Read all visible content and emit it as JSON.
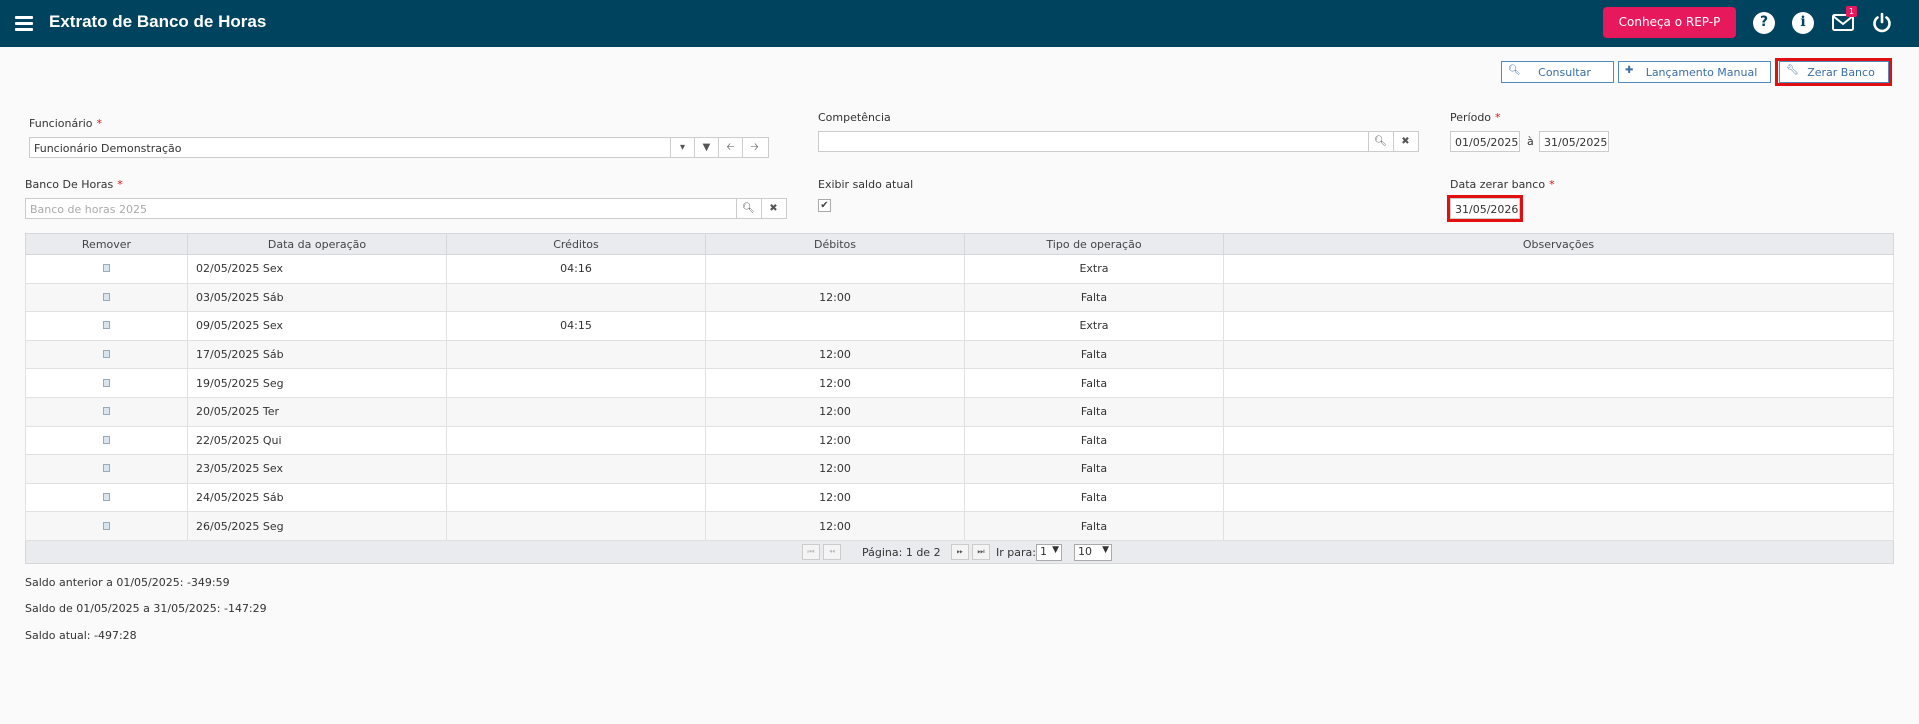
{
  "header": {
    "title": "Extrato de Banco de Horas",
    "rep_button": "Conheça o REP-P",
    "mail_badge": "1",
    "help_glyph": "?",
    "info_glyph": "i"
  },
  "actions": {
    "consultar": "Consultar",
    "lancamento": "Lançamento Manual",
    "zerar": "Zerar Banco"
  },
  "form": {
    "funcionario_label": "Funcionário",
    "funcionario_value": "Funcionário Demonstração",
    "competencia_label": "Competência",
    "competencia_value": "",
    "periodo_label": "Período",
    "periodo_inicio": "01/05/2025",
    "periodo_sep": "à",
    "periodo_fim": "31/05/2025",
    "banco_label": "Banco De Horas",
    "banco_placeholder": "Banco de horas 2025",
    "exibir_label": "Exibir saldo atual",
    "data_zerar_label": "Data zerar banco",
    "data_zerar_value": "31/05/2026",
    "required_mark": "*"
  },
  "table": {
    "columns": [
      "Remover",
      "Data da operação",
      "Créditos",
      "Débitos",
      "Tipo de operação",
      "Observações"
    ],
    "rows": [
      {
        "date": "02/05/2025 Sex",
        "credit": "04:16",
        "debit": "",
        "type": "Extra",
        "obs": ""
      },
      {
        "date": "03/05/2025 Sáb",
        "credit": "",
        "debit": "12:00",
        "type": "Falta",
        "obs": ""
      },
      {
        "date": "09/05/2025 Sex",
        "credit": "04:15",
        "debit": "",
        "type": "Extra",
        "obs": ""
      },
      {
        "date": "17/05/2025 Sáb",
        "credit": "",
        "debit": "12:00",
        "type": "Falta",
        "obs": ""
      },
      {
        "date": "19/05/2025 Seg",
        "credit": "",
        "debit": "12:00",
        "type": "Falta",
        "obs": ""
      },
      {
        "date": "20/05/2025 Ter",
        "credit": "",
        "debit": "12:00",
        "type": "Falta",
        "obs": ""
      },
      {
        "date": "22/05/2025 Qui",
        "credit": "",
        "debit": "12:00",
        "type": "Falta",
        "obs": ""
      },
      {
        "date": "23/05/2025 Sex",
        "credit": "",
        "debit": "12:00",
        "type": "Falta",
        "obs": ""
      },
      {
        "date": "24/05/2025 Sáb",
        "credit": "",
        "debit": "12:00",
        "type": "Falta",
        "obs": ""
      },
      {
        "date": "26/05/2025 Seg",
        "credit": "",
        "debit": "12:00",
        "type": "Falta",
        "obs": ""
      }
    ]
  },
  "pager": {
    "page_text": "Página: 1 de 2",
    "goto_label": "Ir para:",
    "goto_value": "1",
    "page_size": "10"
  },
  "summary": {
    "saldo_anterior": "Saldo anterior a 01/05/2025: -349:59",
    "saldo_periodo": "Saldo de 01/05/2025 a 31/05/2025: -147:29",
    "saldo_atual": "Saldo atual: -497:28"
  }
}
